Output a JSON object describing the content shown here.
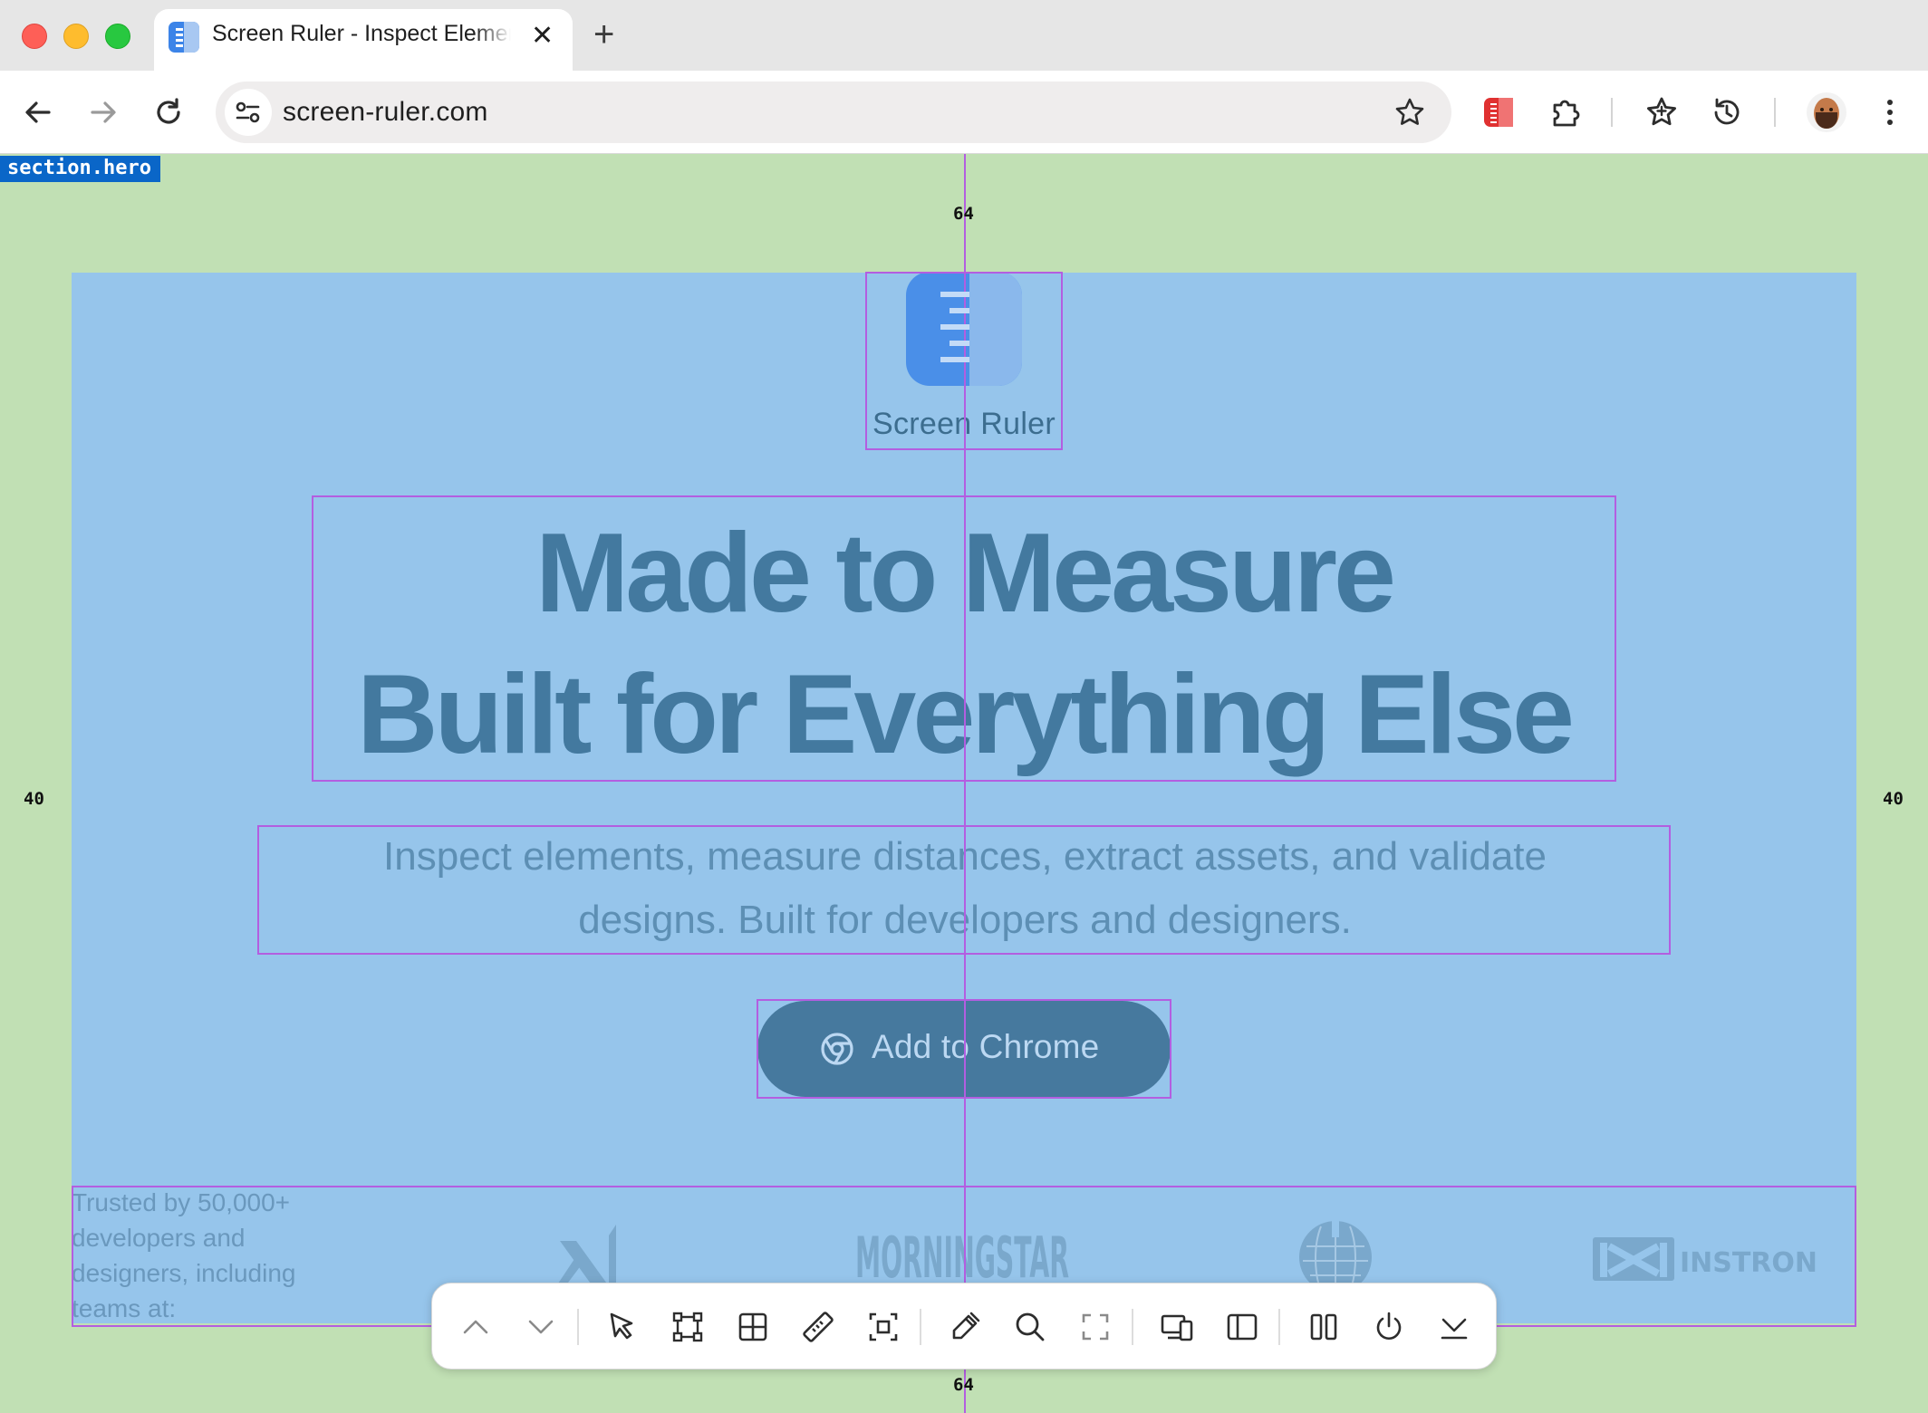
{
  "browser": {
    "tab_title": "Screen Ruler - Inspect Elements",
    "url": "screen-ruler.com"
  },
  "inspector": {
    "selected_element": "section.hero",
    "margin_top": "64",
    "margin_bottom": "64",
    "margin_left": "40",
    "margin_right": "40",
    "highlight_color": "#b35ee0"
  },
  "hero": {
    "brand": "Screen Ruler",
    "headline_line1": "Made to Measure",
    "headline_line2": "Built for Everything Else",
    "subtext_line1": "Inspect elements, measure distances, extract assets, and validate",
    "subtext_line2": "designs. Built for developers and designers.",
    "cta_label": "Add to Chrome",
    "trusted_text": "Trusted by 50,000+ developers and designers, including teams at:",
    "partner_logos": [
      "x-ai-logo",
      "morningstar-logo",
      "wikipedia-globe-logo",
      "instron-logo"
    ],
    "morningstar": "MORNINGSTAR",
    "instron": "INSTRON"
  },
  "ruler_toolbar": {
    "buttons": [
      "chevron-up-icon",
      "chevron-down-icon",
      "pointer-icon",
      "bounding-box-icon",
      "grid-icon",
      "ruler-icon",
      "dashed-select-icon",
      "eyedropper-icon",
      "magnifier-icon",
      "fullscreen-icon",
      "devices-icon",
      "sidebar-icon",
      "columns-icon",
      "power-icon",
      "collapse-icon"
    ]
  }
}
